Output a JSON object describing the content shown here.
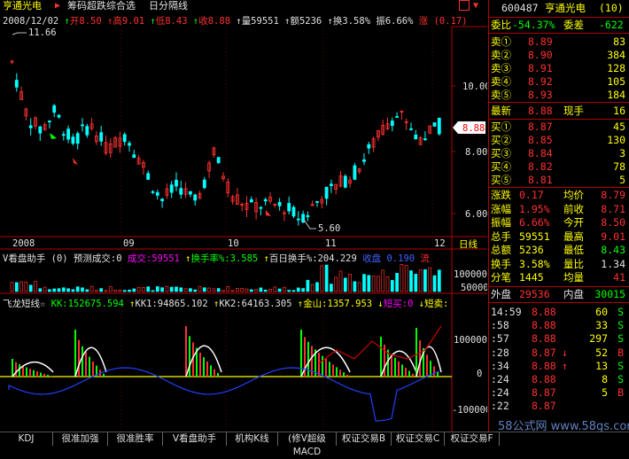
{
  "top_bar": {
    "stock_name": "亨通光电",
    "formula_name": "筹码超跌综合选",
    "period": "日分隔线",
    "date": "2008/12/02",
    "open": "开8.50",
    "high": "高9.01",
    "low": "低8.43",
    "close": "收8.88",
    "volume": "量59551",
    "amount": "额5236",
    "turnover": "换3.58%",
    "amplitude": "振6.66%",
    "change": "涨 (0.17)"
  },
  "price_chart": {
    "high_label": "11.66",
    "low_label": "5.60",
    "y_ticks": [
      "10.00",
      "8.00",
      "6.00"
    ],
    "current_price": "8.88"
  },
  "date_axis": {
    "labels": [
      "2008",
      "09",
      "10",
      "11",
      "12"
    ],
    "day_label": "日线"
  },
  "volume_panel": {
    "title": "V看盘助手 (0) 预测成交:0",
    "vol": "成交:59551",
    "turn": "换手率%:3.585",
    "baidu": "百日换手%:204.229",
    "shou": "收盘 0.190",
    "liu": "流",
    "y_ticks": [
      "100000",
      "50000"
    ]
  },
  "fly_panel": {
    "title": "飞龙短线☆",
    "kk": "KK:152675.594",
    "kk1": "KK1:94865.102",
    "kk2": "KK2:64163.305",
    "jinshan": "金山:1357.953",
    "short_buy": "短买:0",
    "short_sell": "短卖:",
    "y_ticks": [
      "100000",
      "0",
      "-100000"
    ]
  },
  "quote": {
    "code": "600487",
    "name": "亨通光电",
    "count": "(10)",
    "weibi_label": "委比",
    "weibi_value": "-54.37%",
    "weicha_label": "委差",
    "weicha_value": "-622",
    "sells": [
      {
        "label": "卖⑤",
        "price": "8.93",
        "vol": "184"
      },
      {
        "label": "卖④",
        "price": "8.92",
        "vol": "105"
      },
      {
        "label": "卖③",
        "price": "8.91",
        "vol": "128"
      },
      {
        "label": "卖②",
        "price": "8.90",
        "vol": "384"
      },
      {
        "label": "卖①",
        "price": "8.89",
        "vol": "83"
      }
    ],
    "latest_label": "最新",
    "latest_value": "8.88",
    "xianshou_label": "现手",
    "xianshou_value": "16",
    "buys": [
      {
        "label": "买①",
        "price": "8.87",
        "vol": "45"
      },
      {
        "label": "买②",
        "price": "8.85",
        "vol": "130"
      },
      {
        "label": "买③",
        "price": "8.84",
        "vol": "3"
      },
      {
        "label": "买④",
        "price": "8.82",
        "vol": "78"
      },
      {
        "label": "买⑤",
        "price": "8.81",
        "vol": "5"
      }
    ],
    "stats": [
      {
        "l1": "涨跌",
        "v1": "0.17",
        "l2": "均价",
        "v2": "8.79"
      },
      {
        "l1": "涨幅",
        "v1": "1.95%",
        "l2": "前收",
        "v2": "8.71"
      },
      {
        "l1": "振幅",
        "v1": "6.66%",
        "l2": "今开",
        "v2": "8.50"
      },
      {
        "l1": "总手",
        "v1": "59551",
        "l2": "最高",
        "v2": "9.01"
      },
      {
        "l1": "总额",
        "v1": "5236",
        "l2": "最低",
        "v2": "8.43"
      },
      {
        "l1": "换手",
        "v1": "3.58%",
        "l2": "量比",
        "v2": "1.34"
      },
      {
        "l1": "分笔",
        "v1": "1445",
        "l2": "均量",
        "v2": "41"
      }
    ],
    "outer_label": "外盘",
    "outer_value": "29536",
    "inner_label": "内盘",
    "inner_value": "30015",
    "ticks": [
      {
        "time": "14:59",
        "price": "8.88",
        "vol": "60",
        "bs": "S"
      },
      {
        "time": ":58",
        "price": "8.88",
        "vol": "33",
        "bs": "S"
      },
      {
        "time": ":57",
        "price": "8.88",
        "vol": "297",
        "bs": "S"
      },
      {
        "time": ":28",
        "price": "8.87",
        "vol": "52",
        "bs": "B",
        "arrow": "↓"
      },
      {
        "time": ":34",
        "price": "8.88",
        "vol": "13",
        "bs": "S",
        "arrow": "↑"
      },
      {
        "time": ":24",
        "price": "8.88",
        "vol": "8",
        "bs": "S"
      },
      {
        "time": ":24",
        "price": "8.87",
        "vol": "5",
        "bs": "B"
      },
      {
        "time": ":22",
        "price": "8.87",
        "vol": "",
        "bs": ""
      }
    ]
  },
  "bottom_tabs": [
    "KDJ",
    "很准加强",
    "很准胜率",
    "V看盘助手",
    "机构K线",
    "(修V超级MACD",
    "权证交易B",
    "权证交易C",
    "权证交易F"
  ],
  "watermark": "58公式网 www.58gs.com"
}
